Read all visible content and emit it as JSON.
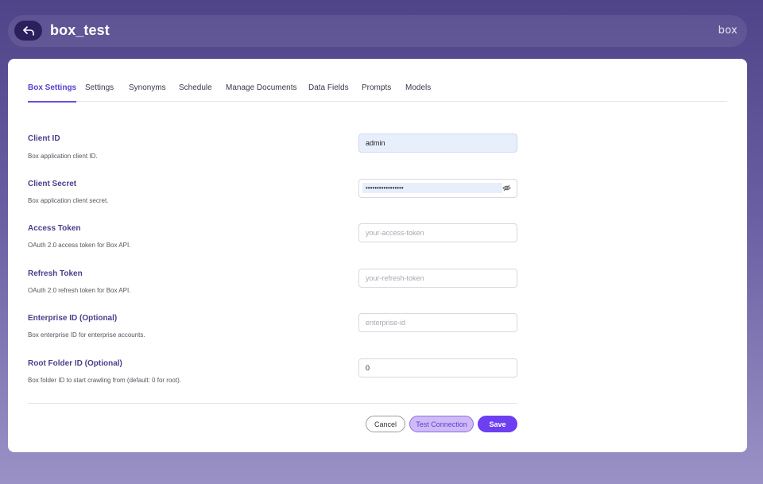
{
  "header": {
    "title": "box_test",
    "logo_text": "box"
  },
  "tabs": [
    {
      "label": "Box Settings",
      "active": true
    },
    {
      "label": "Settings"
    },
    {
      "label": "Synonyms"
    },
    {
      "label": "Schedule"
    },
    {
      "label": "Manage Documents"
    },
    {
      "label": "Data Fields"
    },
    {
      "label": "Prompts"
    },
    {
      "label": "Models"
    }
  ],
  "fields": {
    "client_id": {
      "label": "Client ID",
      "description": "Box application client ID.",
      "value": "admin",
      "placeholder": ""
    },
    "client_secret": {
      "label": "Client Secret",
      "description": "Box application client secret.",
      "value": "•••••••••••••••••",
      "placeholder": ""
    },
    "access_token": {
      "label": "Access Token",
      "description": "OAuth 2.0 access token for Box API.",
      "value": "",
      "placeholder": "your-access-token"
    },
    "refresh_token": {
      "label": "Refresh Token",
      "description": "OAuth 2.0 refresh token for Box API.",
      "value": "",
      "placeholder": "your-refresh-token"
    },
    "enterprise_id": {
      "label": "Enterprise ID (Optional)",
      "description": "Box enterprise ID for enterprise accounts.",
      "value": "",
      "placeholder": "enterprise-id"
    },
    "root_folder_id": {
      "label": "Root Folder ID (Optional)",
      "description": "Box folder ID to start crawling from (default: 0 for root).",
      "value": "0",
      "placeholder": ""
    }
  },
  "actions": {
    "cancel": "Cancel",
    "test": "Test Connection",
    "save": "Save"
  },
  "colors": {
    "accent": "#6d3ff0",
    "label": "#4a3f8a",
    "header_bg": "#4f4489"
  },
  "icons": {
    "back": "arrow-back-icon",
    "eye": "eye-off-icon"
  }
}
